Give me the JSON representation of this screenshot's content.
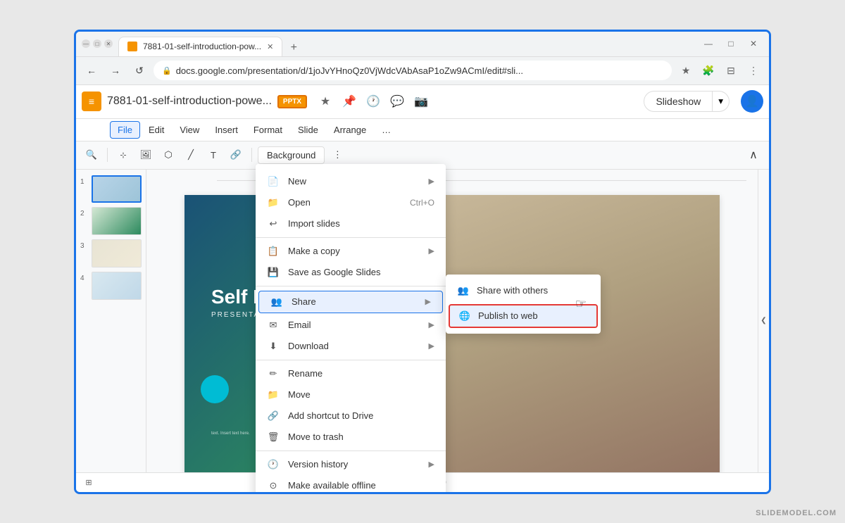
{
  "browser": {
    "tab_title": "7881-01-self-introduction-pow...",
    "new_tab_plus": "+",
    "address": "docs.google.com/presentation/d/1joJvYHnoQz0VjWdcVAbAsaP1oZw9ACmI/edit#sli...",
    "back_btn": "←",
    "forward_btn": "→",
    "refresh_btn": "↺",
    "minimize": "—",
    "maximize": "□",
    "close": "✕"
  },
  "header": {
    "file_title": "7881-01-self-introduction-powe...",
    "pptx_badge": "PPTX",
    "slideshow_label": "Slideshow",
    "share_icon": "👤"
  },
  "menu_bar": {
    "items": [
      "File",
      "Edit",
      "View",
      "Insert",
      "Format",
      "Slide",
      "Arrange",
      "…"
    ]
  },
  "file_menu": {
    "sections": [
      {
        "items": [
          {
            "icon": "📄",
            "label": "New",
            "arrow": true
          },
          {
            "icon": "📁",
            "label": "Open",
            "shortcut": "Ctrl+O"
          },
          {
            "icon": "↩",
            "label": "Import slides"
          }
        ]
      },
      {
        "items": [
          {
            "icon": "📋",
            "label": "Make a copy",
            "arrow": true
          },
          {
            "icon": "💾",
            "label": "Save as Google Slides"
          }
        ]
      },
      {
        "items": [
          {
            "icon": "👥",
            "label": "Share",
            "arrow": true,
            "highlighted": true
          },
          {
            "icon": "✉",
            "label": "Email",
            "arrow": true
          },
          {
            "icon": "⬇",
            "label": "Download",
            "arrow": true
          }
        ]
      },
      {
        "items": [
          {
            "icon": "✏",
            "label": "Rename"
          },
          {
            "icon": "📁",
            "label": "Move"
          },
          {
            "icon": "🔗",
            "label": "Add shortcut to Drive"
          },
          {
            "icon": "🗑",
            "label": "Move to trash"
          }
        ]
      },
      {
        "items": [
          {
            "icon": "🕐",
            "label": "Version history",
            "arrow": true
          },
          {
            "icon": "⊙",
            "label": "Make available offline"
          }
        ]
      }
    ]
  },
  "share_submenu": {
    "items": [
      {
        "icon": "👥",
        "label": "Share with others"
      },
      {
        "icon": "🌐",
        "label": "Publish to web",
        "highlighted": true
      }
    ]
  },
  "slide": {
    "main_title": "Self Introduction",
    "subtitle": "PRESENTATION TEMPLATE",
    "small_text": "text. Insert\ntext here."
  },
  "slides_panel": {
    "slides": [
      {
        "num": "1"
      },
      {
        "num": "2"
      },
      {
        "num": "3"
      },
      {
        "num": "4"
      }
    ]
  },
  "toolbar": {
    "background_label": "Background",
    "more_icon": "⋮",
    "collapse_icon": "∧"
  },
  "watermark": {
    "text": "SLIDEMODEL.COM"
  }
}
